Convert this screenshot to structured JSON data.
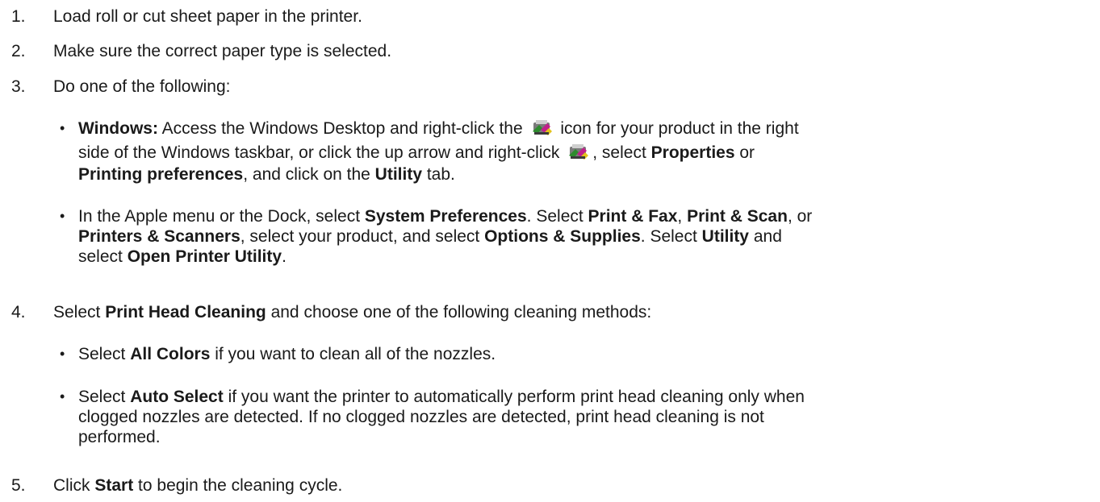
{
  "steps": [
    {
      "num": "1.",
      "text": "Load roll or cut sheet paper in the printer."
    },
    {
      "num": "2.",
      "text": "Make sure the correct paper type is selected."
    },
    {
      "num": "3.",
      "text": "Do one of the following:"
    },
    {
      "num": "4.",
      "pre": "Select ",
      "bold": "Print Head Cleaning",
      "post": " and choose one of the following cleaning methods:"
    },
    {
      "num": "5.",
      "pre": "Click ",
      "bold": "Start",
      "post": " to begin the cleaning cycle."
    }
  ],
  "step3_bullets": {
    "windows": {
      "label": "Windows:",
      "t1": " Access the Windows Desktop and right-click the ",
      "t2": " icon for your product in the right",
      "t3": "side of the Windows taskbar, or click the up arrow and right-click ",
      "t4": ", select ",
      "b1": "Properties",
      "t5": " or",
      "b2": "Printing preferences",
      "t6": ", and click on the ",
      "b3": "Utility",
      "t7": " tab."
    },
    "mac": {
      "t1": "In the Apple menu or the Dock, select ",
      "b1": "System Preferences",
      "t2": ". Select ",
      "b2": "Print & Fax",
      "t3": ", ",
      "b3": "Print & Scan",
      "t4": ", or",
      "b4": "Printers & Scanners",
      "t5": ", select your product, and select ",
      "b5": "Options & Supplies",
      "t6": ". Select ",
      "b6": "Utility",
      "t7": " and",
      "t8": "select ",
      "b7": "Open Printer Utility",
      "t9": "."
    }
  },
  "step4_bullets": {
    "all": {
      "pre": "Select ",
      "bold": "All Colors",
      "post": " if you want to clean all of the nozzles."
    },
    "auto": {
      "pre": "Select ",
      "bold": "Auto Select",
      "l1": " if you want the printer to automatically perform print head cleaning only when",
      "l2": "clogged nozzles are detected. If no clogged nozzles are detected, print head cleaning is not",
      "l3": "performed."
    }
  },
  "bullet_glyph": "•",
  "icons": {
    "printer": "epson-printer-status-icon"
  }
}
